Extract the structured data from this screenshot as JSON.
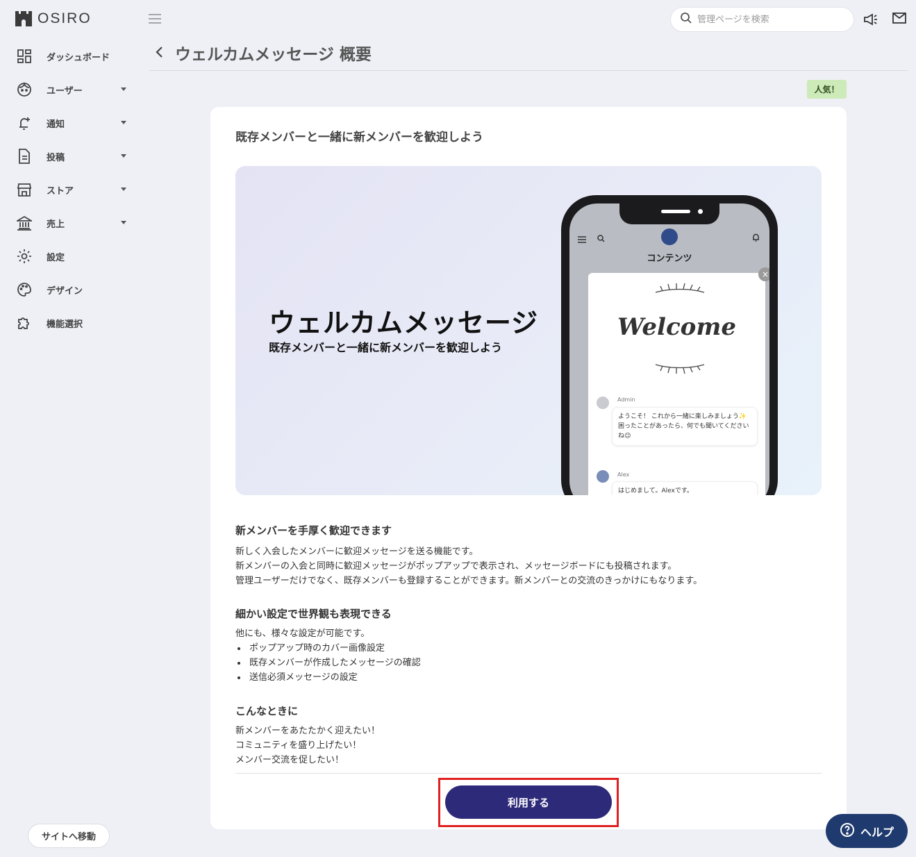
{
  "app": {
    "brand": "OSIRO"
  },
  "sidebar": {
    "items": [
      {
        "label": "ダッシュボード",
        "icon": "dashboard-icon",
        "has_caret": false
      },
      {
        "label": "ユーザー",
        "icon": "user-face-icon",
        "has_caret": true
      },
      {
        "label": "通知",
        "icon": "bell-plus-icon",
        "has_caret": true
      },
      {
        "label": "投稿",
        "icon": "document-icon",
        "has_caret": true
      },
      {
        "label": "ストア",
        "icon": "store-icon",
        "has_caret": true
      },
      {
        "label": "売上",
        "icon": "bank-icon",
        "has_caret": true
      },
      {
        "label": "設定",
        "icon": "gear-icon",
        "has_caret": false
      },
      {
        "label": "デザイン",
        "icon": "palette-icon",
        "has_caret": false
      },
      {
        "label": "機能選択",
        "icon": "puzzle-icon",
        "has_caret": false
      }
    ],
    "site_button": "サイトへ移動"
  },
  "header": {
    "search_placeholder": "管理ページを検索",
    "page_title": "ウェルカムメッセージ 概要"
  },
  "badge": "人気！",
  "card": {
    "title": "既存メンバーと一緒に新メンバーを歓迎しよう",
    "hero": {
      "title": "ウェルカムメッセージ",
      "subtitle": "既存メンバーと一緒に新メンバーを歓迎しよう",
      "phone": {
        "app_title": "コンテンツ",
        "welcome": "Welcome",
        "close": "×",
        "chat": [
          {
            "name": "Admin",
            "text": "ようこそ！ これから一緒に楽しみましょう✨\n困ったことがあったら、何でも聞いてくださいね😉"
          },
          {
            "name": "Alex",
            "text": "はじめまして。Alexです。"
          }
        ]
      }
    },
    "section1": {
      "heading": "新メンバーを手厚く歓迎できます",
      "lines": [
        "新しく入会したメンバーに歓迎メッセージを送る機能です。",
        "新メンバーの入会と同時に歓迎メッセージがポップアップで表示され、メッセージボードにも投稿されます。",
        "管理ユーザーだけでなく、既存メンバーも登録することができます。新メンバーとの交流のきっかけにもなります。"
      ]
    },
    "section2": {
      "heading": "細かい設定で世界観も表現できる",
      "intro": "他にも、様々な設定が可能です。",
      "bullets": [
        "ポップアップ時のカバー画像設定",
        "既存メンバーが作成したメッセージの確認",
        "送信必須メッセージの設定"
      ]
    },
    "section3": {
      "heading": "こんなときに",
      "lines": [
        "新メンバーをあたたかく迎えたい！",
        "コミュニティを盛り上げたい！",
        "メンバー交流を促したい！"
      ]
    },
    "use_button": "利用する"
  },
  "help_button": "ヘルプ",
  "colors": {
    "primary_button": "#2e2a7a",
    "help_button": "#1f3a6e",
    "badge_bg": "#cdeab9",
    "highlight": "#e02020"
  }
}
